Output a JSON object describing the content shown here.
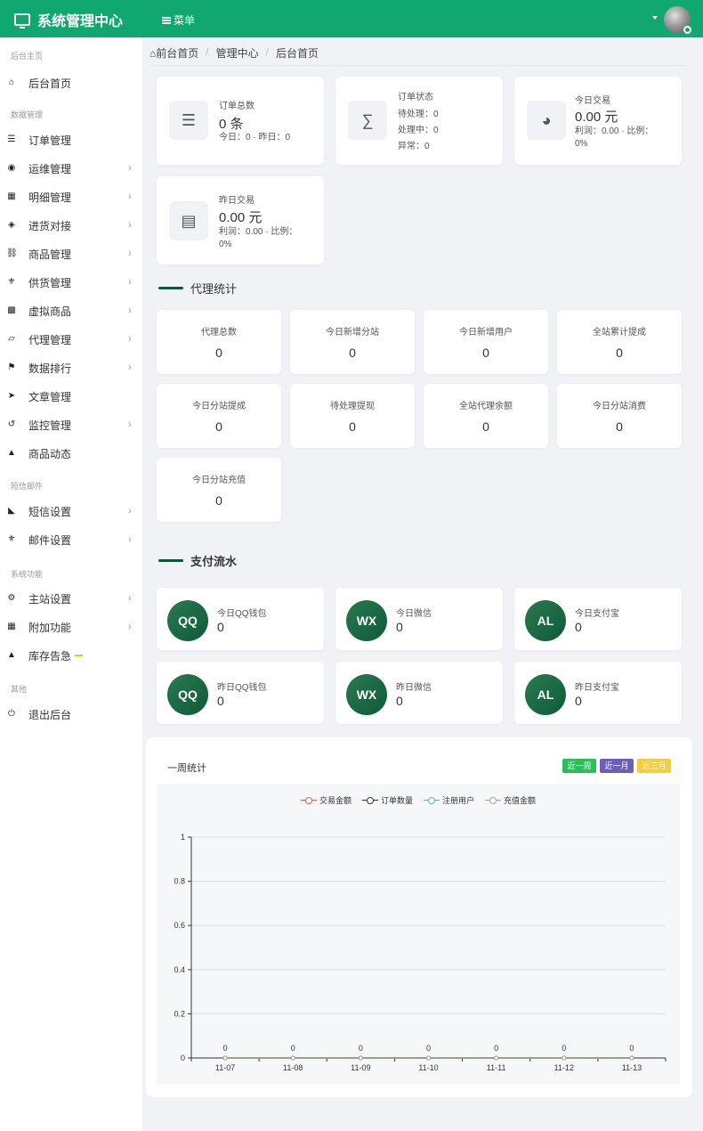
{
  "header": {
    "brand": "系统管理中心",
    "menu_label": "菜单"
  },
  "sidebar": {
    "sections": [
      "后台主页",
      "数据管理",
      "短信邮件",
      "系统功能",
      "其他"
    ],
    "items": [
      {
        "label": "后台首页",
        "icon": "home-icon",
        "arrow": false
      },
      {
        "label": "订单管理",
        "icon": "list-icon",
        "arrow": false
      },
      {
        "label": "运维管理",
        "icon": "comments-icon",
        "arrow": true
      },
      {
        "label": "明细管理",
        "icon": "calendar-icon",
        "arrow": true
      },
      {
        "label": "进货对接",
        "icon": "cubes-icon",
        "arrow": true
      },
      {
        "label": "商品管理",
        "icon": "cart-icon",
        "arrow": true
      },
      {
        "label": "供货管理",
        "icon": "cutlery-icon",
        "arrow": true
      },
      {
        "label": "虚拟商品",
        "icon": "grid-icon",
        "arrow": true
      },
      {
        "label": "代理管理",
        "icon": "sitemap-icon",
        "arrow": true
      },
      {
        "label": "数据排行",
        "icon": "flag-icon",
        "arrow": true
      },
      {
        "label": "文章管理",
        "icon": "send-icon",
        "arrow": false
      },
      {
        "label": "监控管理",
        "icon": "retweet-icon",
        "arrow": true
      },
      {
        "label": "商品动态",
        "icon": "bell-icon",
        "arrow": false
      },
      {
        "label": "短信设置",
        "icon": "area-chart-icon",
        "arrow": true
      },
      {
        "label": "邮件设置",
        "icon": "cutlery-icon",
        "arrow": true
      },
      {
        "label": "主站设置",
        "icon": "gear-icon",
        "arrow": true
      },
      {
        "label": "附加功能",
        "icon": "calendar-icon",
        "arrow": true
      },
      {
        "label": "库存告急",
        "icon": "bell-icon",
        "arrow": false
      },
      {
        "label": "退出后台",
        "icon": "power-icon",
        "arrow": false
      }
    ]
  },
  "breadcrumb": [
    "前台首页",
    "管理中心",
    "后台首页"
  ],
  "overview": {
    "orders": {
      "title": "订单总数",
      "value": "0 条",
      "sub": "今日：0 · 昨日：0"
    },
    "status": {
      "title": "订单状态",
      "lines": [
        "待处理：0",
        "处理中：0",
        "异常：0"
      ]
    },
    "today": {
      "title": "今日交易",
      "value": "0.00 元",
      "sub1": "利润：0.00 · 比例：",
      "sub2": "0%"
    },
    "yesterday": {
      "title": "昨日交易",
      "value": "0.00 元",
      "sub1": "利润：0.00 · 比例：",
      "sub2": "0%"
    }
  },
  "agent_section": {
    "title": "代理统计",
    "stats": [
      {
        "label": "代理总数",
        "value": "0"
      },
      {
        "label": "今日新增分站",
        "value": "0"
      },
      {
        "label": "今日新增用户",
        "value": "0"
      },
      {
        "label": "全站累计提成",
        "value": "0"
      },
      {
        "label": "今日分站提成",
        "value": "0"
      },
      {
        "label": "待处理提现",
        "value": "0"
      },
      {
        "label": "全站代理余额",
        "value": "0"
      },
      {
        "label": "今日分站消费",
        "value": "0"
      },
      {
        "label": "今日分站充值",
        "value": "0"
      }
    ]
  },
  "payment_section": {
    "title": "支付流水",
    "items": [
      {
        "badge": "QQ",
        "label": "今日QQ钱包",
        "value": "0"
      },
      {
        "badge": "WX",
        "label": "今日微信",
        "value": "0"
      },
      {
        "badge": "AL",
        "label": "今日支付宝",
        "value": "0"
      },
      {
        "badge": "QQ",
        "label": "昨日QQ钱包",
        "value": "0"
      },
      {
        "badge": "WX",
        "label": "昨日微信",
        "value": "0"
      },
      {
        "badge": "AL",
        "label": "昨日支付宝",
        "value": "0"
      }
    ]
  },
  "chart_panel": {
    "title": "一周统计",
    "ranges": [
      {
        "label": "近一周",
        "color": "#2dbd5b"
      },
      {
        "label": "近一月",
        "color": "#6c5fb5"
      },
      {
        "label": "近三月",
        "color": "#f5cd3d"
      }
    ]
  },
  "colors": {
    "brand": "#10a870",
    "badge": "#1b6b45"
  },
  "chart_data": {
    "type": "line",
    "x": [
      "11-07",
      "11-08",
      "11-09",
      "11-10",
      "11-11",
      "11-12",
      "11-13"
    ],
    "series": [
      {
        "name": "交易金额",
        "values": [
          0,
          0,
          0,
          0,
          0,
          0,
          0
        ],
        "color": "#c96060"
      },
      {
        "name": "订单数量",
        "values": [
          0,
          0,
          0,
          0,
          0,
          0,
          0
        ],
        "color": "#333333"
      },
      {
        "name": "注册用户",
        "values": [
          0,
          0,
          0,
          0,
          0,
          0,
          0
        ],
        "color": "#6aaeaa"
      },
      {
        "name": "充值金额",
        "values": [
          0,
          0,
          0,
          0,
          0,
          0,
          0
        ],
        "color": "#a0a890"
      }
    ],
    "ylim": [
      0,
      1
    ],
    "yticks": [
      "0",
      "0.2",
      "0.4",
      "0.6",
      "0.8",
      "1"
    ],
    "data_labels": [
      "0",
      "0",
      "0",
      "0",
      "0",
      "0",
      "0"
    ],
    "grid": true,
    "legend": "top-center"
  }
}
